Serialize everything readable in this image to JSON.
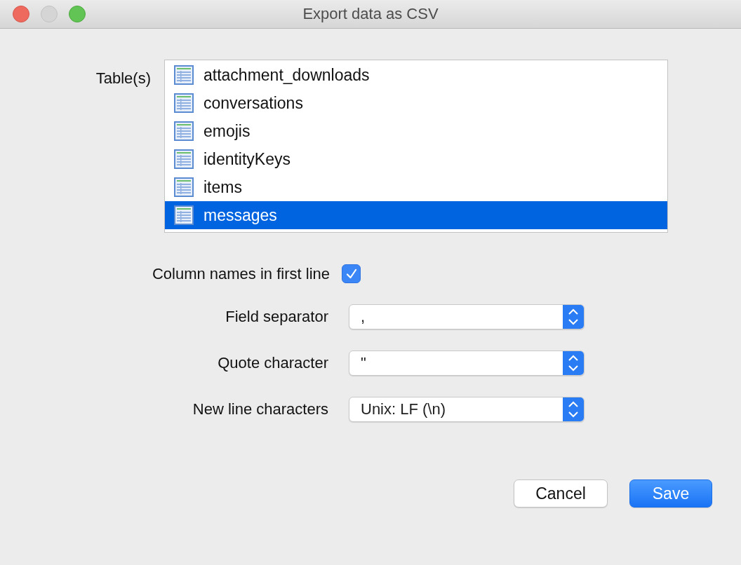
{
  "window": {
    "title": "Export data as CSV"
  },
  "tables": {
    "label": "Table(s)",
    "items": [
      {
        "name": "attachment_downloads",
        "selected": false
      },
      {
        "name": "conversations",
        "selected": false
      },
      {
        "name": "emojis",
        "selected": false
      },
      {
        "name": "identityKeys",
        "selected": false
      },
      {
        "name": "items",
        "selected": false
      },
      {
        "name": "messages",
        "selected": true
      }
    ]
  },
  "column_names": {
    "label": "Column names in first line",
    "checked": true
  },
  "selects": [
    {
      "label": "Field separator",
      "value": ","
    },
    {
      "label": "Quote character",
      "value": "\""
    },
    {
      "label": "New line characters",
      "value": "Unix: LF (\\n)"
    }
  ],
  "buttons": [
    {
      "label": "Cancel",
      "kind": "secondary"
    },
    {
      "label": "Save",
      "kind": "primary"
    }
  ]
}
